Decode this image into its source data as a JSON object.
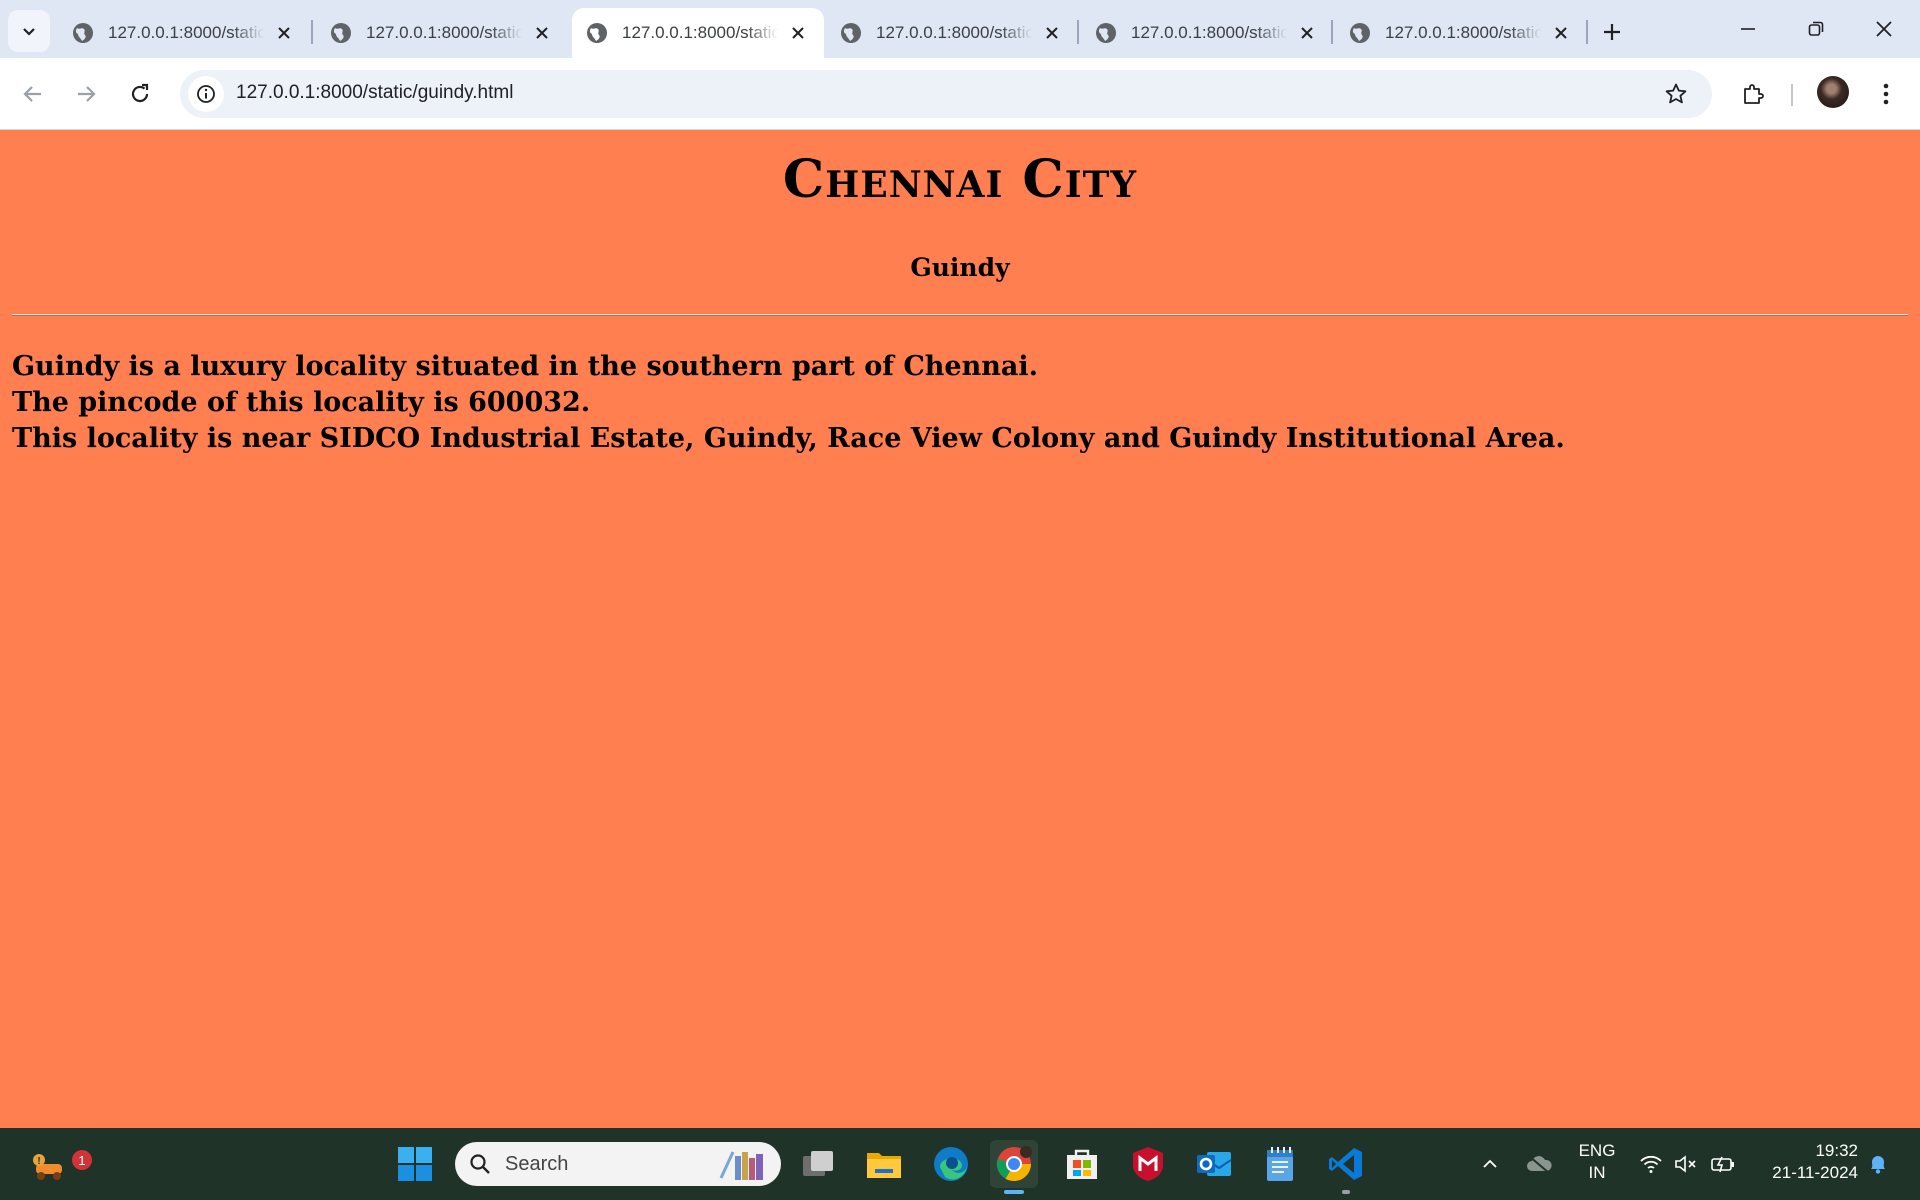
{
  "browser": {
    "tabs": [
      {
        "title": "127.0.0.1:8000/static/",
        "active": false
      },
      {
        "title": "127.0.0.1:8000/static/",
        "active": false
      },
      {
        "title": "127.0.0.1:8000/static/",
        "active": true
      },
      {
        "title": "127.0.0.1:8000/static/",
        "active": false
      },
      {
        "title": "127.0.0.1:8000/static/",
        "active": false
      },
      {
        "title": "127.0.0.1:8000/static/",
        "active": false
      }
    ],
    "address": "127.0.0.1:8000/static/guindy.html"
  },
  "page": {
    "heading": "Chennai City",
    "subheading": "Guindy",
    "lines": [
      "Guindy is a luxury locality situated in the southern part of Chennai.",
      "The pincode of this locality is 600032.",
      "This locality is near SIDCO Industrial Estate, Guindy, Race View Colony and Guindy Institutional Area."
    ],
    "background": "#ff7f50"
  },
  "taskbar": {
    "search_placeholder": "Search",
    "notification_count": "1",
    "language": [
      "ENG",
      "IN"
    ],
    "time": "19:32",
    "date": "21-11-2024",
    "pinned": [
      "widgets-icon",
      "start-icon",
      "task-view-icon",
      "file-explorer-icon",
      "edge-icon",
      "chrome-icon",
      "store-icon",
      "mcafee-icon",
      "outlook-icon",
      "notepad-icon",
      "vscode-icon"
    ]
  }
}
